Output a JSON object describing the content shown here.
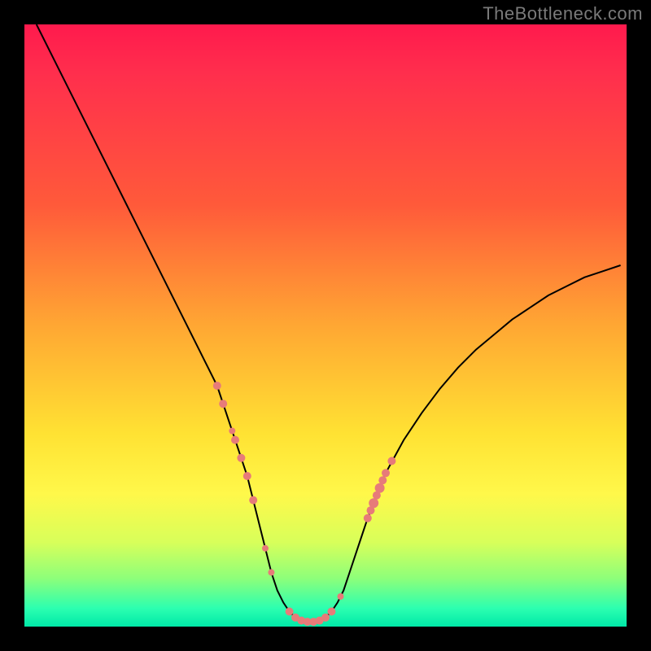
{
  "watermark": "TheBottleneck.com",
  "colors": {
    "frame": "#000000",
    "gradient_top": "#ff1a4d",
    "gradient_mid1": "#ffa733",
    "gradient_mid2": "#ffe233",
    "gradient_bottom": "#00e8a8",
    "curve": "#000000",
    "markers": "#e77b79"
  },
  "chart_data": {
    "type": "line",
    "title": "",
    "xlabel": "",
    "ylabel": "",
    "xlim": [
      0,
      100
    ],
    "ylim": [
      0,
      100
    ],
    "x": [
      2,
      5,
      8,
      11,
      14,
      17,
      20,
      23,
      26,
      29,
      30,
      31,
      32,
      33,
      34,
      35,
      36,
      37,
      38,
      39,
      40,
      41,
      42,
      43,
      44,
      45,
      46,
      47,
      48,
      49,
      50,
      51,
      52,
      53,
      54,
      55,
      56,
      57,
      58,
      59,
      60,
      63,
      66,
      69,
      72,
      75,
      78,
      81,
      84,
      87,
      90,
      93,
      96,
      99
    ],
    "y": [
      100,
      94,
      88,
      82,
      76,
      70,
      64,
      58,
      52,
      46,
      44,
      42,
      40,
      37,
      34,
      31,
      28,
      25,
      21,
      17,
      13,
      9,
      6,
      4,
      2.5,
      1.5,
      1,
      0.8,
      0.8,
      1,
      1.5,
      2.5,
      4,
      6,
      9,
      12,
      15,
      18,
      20.5,
      23,
      25.5,
      31,
      35.5,
      39.5,
      43,
      46,
      48.5,
      51,
      53,
      55,
      56.5,
      58,
      59,
      60
    ],
    "markers": {
      "x": [
        32,
        33,
        34.5,
        35,
        36,
        37,
        38,
        40,
        41,
        44,
        45,
        46,
        47,
        48,
        49,
        50,
        51,
        52.5,
        57,
        57.5,
        58,
        58.5,
        59,
        59.5,
        60,
        61
      ],
      "y": [
        40,
        37,
        32.5,
        31,
        28,
        25,
        21,
        13,
        9,
        2.5,
        1.5,
        1,
        0.8,
        0.8,
        1,
        1.5,
        2.5,
        5,
        18,
        19.3,
        20.5,
        21.8,
        23,
        24.3,
        25.5,
        27.5
      ],
      "r": [
        5,
        5,
        4,
        5,
        5,
        5,
        5,
        4,
        4,
        5,
        5,
        5,
        5,
        5,
        5,
        5,
        5,
        4,
        5,
        5,
        6,
        5,
        6,
        5,
        5,
        5
      ]
    }
  }
}
